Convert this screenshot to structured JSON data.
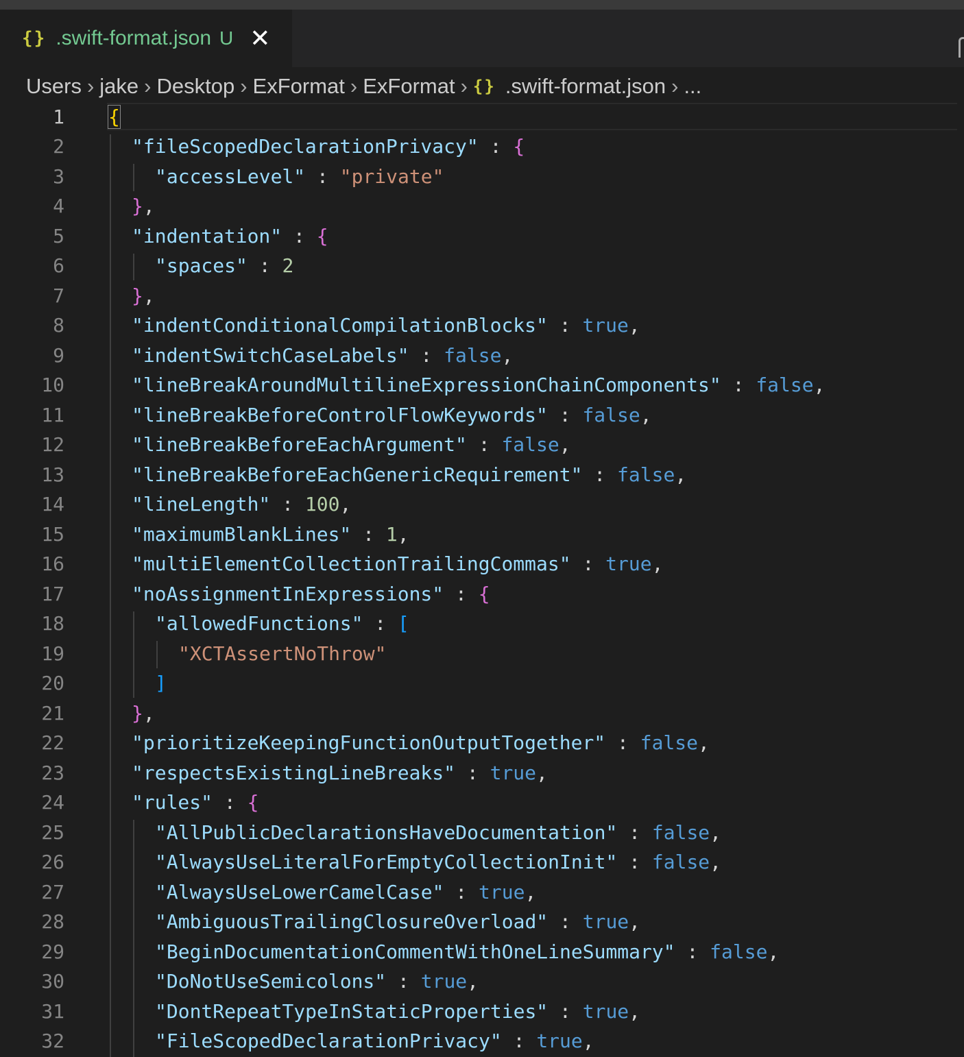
{
  "tab": {
    "icon": "{}",
    "title": ".swift-format.json",
    "status": "U",
    "close": "✕"
  },
  "breadcrumb": {
    "items": [
      "Users",
      "jake",
      "Desktop",
      "ExFormat",
      "ExFormat"
    ],
    "file_icon": "{}",
    "file": ".swift-format.json",
    "more": "...",
    "separator": "›"
  },
  "lines": [
    {
      "n": "1",
      "indent": 0,
      "tokens": [
        [
          "br1",
          "{"
        ]
      ]
    },
    {
      "n": "2",
      "indent": 1,
      "tokens": [
        [
          "k",
          "\"fileScopedDeclarationPrivacy\""
        ],
        [
          "p",
          " : "
        ],
        [
          "br2",
          "{"
        ]
      ]
    },
    {
      "n": "3",
      "indent": 2,
      "tokens": [
        [
          "k",
          "\"accessLevel\""
        ],
        [
          "p",
          " : "
        ],
        [
          "s",
          "\"private\""
        ]
      ]
    },
    {
      "n": "4",
      "indent": 1,
      "tokens": [
        [
          "br2",
          "}"
        ],
        [
          "p",
          ","
        ]
      ]
    },
    {
      "n": "5",
      "indent": 1,
      "tokens": [
        [
          "k",
          "\"indentation\""
        ],
        [
          "p",
          " : "
        ],
        [
          "br2",
          "{"
        ]
      ]
    },
    {
      "n": "6",
      "indent": 2,
      "tokens": [
        [
          "k",
          "\"spaces\""
        ],
        [
          "p",
          " : "
        ],
        [
          "n",
          "2"
        ]
      ]
    },
    {
      "n": "7",
      "indent": 1,
      "tokens": [
        [
          "br2",
          "}"
        ],
        [
          "p",
          ","
        ]
      ]
    },
    {
      "n": "8",
      "indent": 1,
      "tokens": [
        [
          "k",
          "\"indentConditionalCompilationBlocks\""
        ],
        [
          "p",
          " : "
        ],
        [
          "b",
          "true"
        ],
        [
          "p",
          ","
        ]
      ]
    },
    {
      "n": "9",
      "indent": 1,
      "tokens": [
        [
          "k",
          "\"indentSwitchCaseLabels\""
        ],
        [
          "p",
          " : "
        ],
        [
          "b",
          "false"
        ],
        [
          "p",
          ","
        ]
      ]
    },
    {
      "n": "10",
      "indent": 1,
      "tokens": [
        [
          "k",
          "\"lineBreakAroundMultilineExpressionChainComponents\""
        ],
        [
          "p",
          " : "
        ],
        [
          "b",
          "false"
        ],
        [
          "p",
          ","
        ]
      ]
    },
    {
      "n": "11",
      "indent": 1,
      "tokens": [
        [
          "k",
          "\"lineBreakBeforeControlFlowKeywords\""
        ],
        [
          "p",
          " : "
        ],
        [
          "b",
          "false"
        ],
        [
          "p",
          ","
        ]
      ]
    },
    {
      "n": "12",
      "indent": 1,
      "tokens": [
        [
          "k",
          "\"lineBreakBeforeEachArgument\""
        ],
        [
          "p",
          " : "
        ],
        [
          "b",
          "false"
        ],
        [
          "p",
          ","
        ]
      ]
    },
    {
      "n": "13",
      "indent": 1,
      "tokens": [
        [
          "k",
          "\"lineBreakBeforeEachGenericRequirement\""
        ],
        [
          "p",
          " : "
        ],
        [
          "b",
          "false"
        ],
        [
          "p",
          ","
        ]
      ]
    },
    {
      "n": "14",
      "indent": 1,
      "tokens": [
        [
          "k",
          "\"lineLength\""
        ],
        [
          "p",
          " : "
        ],
        [
          "n",
          "100"
        ],
        [
          "p",
          ","
        ]
      ]
    },
    {
      "n": "15",
      "indent": 1,
      "tokens": [
        [
          "k",
          "\"maximumBlankLines\""
        ],
        [
          "p",
          " : "
        ],
        [
          "n",
          "1"
        ],
        [
          "p",
          ","
        ]
      ]
    },
    {
      "n": "16",
      "indent": 1,
      "tokens": [
        [
          "k",
          "\"multiElementCollectionTrailingCommas\""
        ],
        [
          "p",
          " : "
        ],
        [
          "b",
          "true"
        ],
        [
          "p",
          ","
        ]
      ]
    },
    {
      "n": "17",
      "indent": 1,
      "tokens": [
        [
          "k",
          "\"noAssignmentInExpressions\""
        ],
        [
          "p",
          " : "
        ],
        [
          "br2",
          "{"
        ]
      ]
    },
    {
      "n": "18",
      "indent": 2,
      "tokens": [
        [
          "k",
          "\"allowedFunctions\""
        ],
        [
          "p",
          " : "
        ],
        [
          "br3",
          "["
        ]
      ]
    },
    {
      "n": "19",
      "indent": 3,
      "tokens": [
        [
          "s",
          "\"XCTAssertNoThrow\""
        ]
      ]
    },
    {
      "n": "20",
      "indent": 2,
      "tokens": [
        [
          "br3",
          "]"
        ]
      ]
    },
    {
      "n": "21",
      "indent": 1,
      "tokens": [
        [
          "br2",
          "}"
        ],
        [
          "p",
          ","
        ]
      ]
    },
    {
      "n": "22",
      "indent": 1,
      "tokens": [
        [
          "k",
          "\"prioritizeKeepingFunctionOutputTogether\""
        ],
        [
          "p",
          " : "
        ],
        [
          "b",
          "false"
        ],
        [
          "p",
          ","
        ]
      ]
    },
    {
      "n": "23",
      "indent": 1,
      "tokens": [
        [
          "k",
          "\"respectsExistingLineBreaks\""
        ],
        [
          "p",
          " : "
        ],
        [
          "b",
          "true"
        ],
        [
          "p",
          ","
        ]
      ]
    },
    {
      "n": "24",
      "indent": 1,
      "tokens": [
        [
          "k",
          "\"rules\""
        ],
        [
          "p",
          " : "
        ],
        [
          "br2",
          "{"
        ]
      ]
    },
    {
      "n": "25",
      "indent": 2,
      "tokens": [
        [
          "k",
          "\"AllPublicDeclarationsHaveDocumentation\""
        ],
        [
          "p",
          " : "
        ],
        [
          "b",
          "false"
        ],
        [
          "p",
          ","
        ]
      ]
    },
    {
      "n": "26",
      "indent": 2,
      "tokens": [
        [
          "k",
          "\"AlwaysUseLiteralForEmptyCollectionInit\""
        ],
        [
          "p",
          " : "
        ],
        [
          "b",
          "false"
        ],
        [
          "p",
          ","
        ]
      ]
    },
    {
      "n": "27",
      "indent": 2,
      "tokens": [
        [
          "k",
          "\"AlwaysUseLowerCamelCase\""
        ],
        [
          "p",
          " : "
        ],
        [
          "b",
          "true"
        ],
        [
          "p",
          ","
        ]
      ]
    },
    {
      "n": "28",
      "indent": 2,
      "tokens": [
        [
          "k",
          "\"AmbiguousTrailingClosureOverload\""
        ],
        [
          "p",
          " : "
        ],
        [
          "b",
          "true"
        ],
        [
          "p",
          ","
        ]
      ]
    },
    {
      "n": "29",
      "indent": 2,
      "tokens": [
        [
          "k",
          "\"BeginDocumentationCommentWithOneLineSummary\""
        ],
        [
          "p",
          " : "
        ],
        [
          "b",
          "false"
        ],
        [
          "p",
          ","
        ]
      ]
    },
    {
      "n": "30",
      "indent": 2,
      "tokens": [
        [
          "k",
          "\"DoNotUseSemicolons\""
        ],
        [
          "p",
          " : "
        ],
        [
          "b",
          "true"
        ],
        [
          "p",
          ","
        ]
      ]
    },
    {
      "n": "31",
      "indent": 2,
      "tokens": [
        [
          "k",
          "\"DontRepeatTypeInStaticProperties\""
        ],
        [
          "p",
          " : "
        ],
        [
          "b",
          "true"
        ],
        [
          "p",
          ","
        ]
      ]
    },
    {
      "n": "32",
      "indent": 2,
      "tokens": [
        [
          "k",
          "\"FileScopedDeclarationPrivacy\""
        ],
        [
          "p",
          " : "
        ],
        [
          "b",
          "true"
        ],
        [
          "p",
          ","
        ]
      ]
    }
  ],
  "colors": {
    "background": "#1e1e1e",
    "tab_modified_text": "#73c991",
    "json_icon": "#cbcb41",
    "key": "#9cdcfe",
    "string": "#ce9178",
    "number": "#b5cea8",
    "boolean": "#569cd6",
    "bracket_level1": "#ffd700",
    "bracket_level2": "#da70d6",
    "bracket_level3": "#179fff"
  }
}
